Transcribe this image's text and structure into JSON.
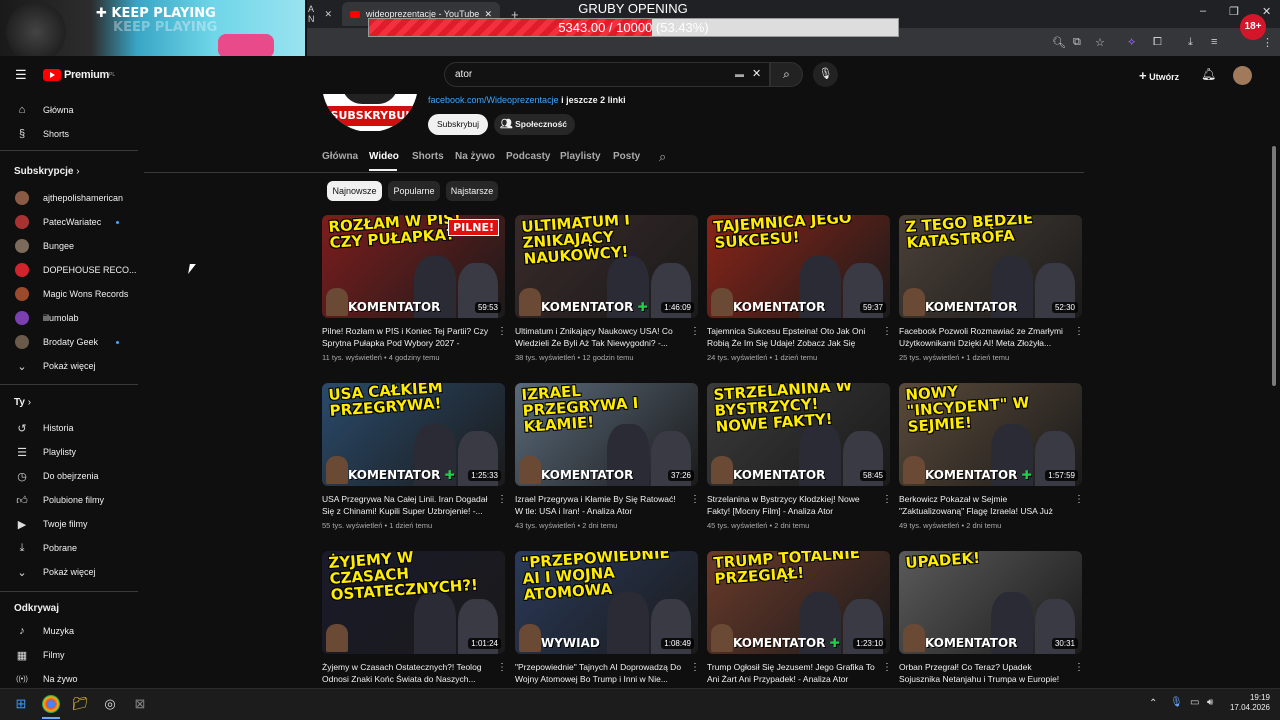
{
  "browser": {
    "tabs": [
      {
        "label": "A N"
      },
      {
        "label": "wideoprezentacje - YouTube"
      }
    ],
    "new_tab": "+",
    "window_controls": [
      "–",
      "❐",
      "✕"
    ]
  },
  "overlays": {
    "keep_playing": "KEEP PLAYING",
    "keep_playing_shadow": "KEEP PLAYING",
    "opening_title": "GRUBY OPENING",
    "progress_text": "5343.00 / 10000 (53.43%)",
    "progress_fraction": 0.5343,
    "age_badge": "18+"
  },
  "youtube": {
    "logo": "Premium",
    "logo_sup": "PL",
    "search_value": "ator",
    "create_label": "Utwórz"
  },
  "channel": {
    "avatar_text": "SUBSKRYBUJ",
    "links": "facebook.com/Wideoprezentacje",
    "links_more": "i jeszcze 2 linki",
    "subscribe": "Subskrybuj",
    "community": "Społeczność",
    "tabs": [
      "Główna",
      "Wideo",
      "Shorts",
      "Na żywo",
      "Podcasty",
      "Playlisty",
      "Posty"
    ],
    "active_tab": "Wideo",
    "chips": [
      "Najnowsze",
      "Popularne",
      "Najstarsze"
    ]
  },
  "sidebar": {
    "top": [
      {
        "label": "Główna",
        "icon": "home-icon"
      },
      {
        "label": "Shorts",
        "icon": "shorts-icon"
      }
    ],
    "subs_header": "Subskrypcje",
    "subs": [
      {
        "label": "ajthepolishamerican",
        "color": "#8a5a44",
        "dot": false
      },
      {
        "label": "PatecWariatec",
        "color": "#a83232",
        "dot": true
      },
      {
        "label": "Bungee",
        "color": "#7c6a5a",
        "dot": false
      },
      {
        "label": "DOPEHOUSE RECO...",
        "color": "#d2242c",
        "dot": false
      },
      {
        "label": "Magic Wons Records",
        "color": "#9b4a2c",
        "dot": false
      },
      {
        "label": "iilumolab",
        "color": "#7a3fb0",
        "dot": false
      },
      {
        "label": "Brodaty Geek",
        "color": "#6a5a4a",
        "dot": true
      }
    ],
    "show_more": "Pokaż więcej",
    "you_header": "Ty",
    "you": [
      {
        "label": "Historia",
        "icon": "history-icon"
      },
      {
        "label": "Playlisty",
        "icon": "playlists-icon"
      },
      {
        "label": "Do obejrzenia",
        "icon": "watch-later-icon"
      },
      {
        "label": "Polubione filmy",
        "icon": "liked-icon"
      },
      {
        "label": "Twoje filmy",
        "icon": "your-videos-icon"
      },
      {
        "label": "Pobrane",
        "icon": "downloads-icon"
      }
    ],
    "show_more_2": "Pokaż więcej",
    "explore_header": "Odkrywaj",
    "explore": [
      {
        "label": "Muzyka",
        "icon": "music-icon"
      },
      {
        "label": "Filmy",
        "icon": "movies-icon"
      },
      {
        "label": "Na żywo",
        "icon": "live-icon"
      }
    ]
  },
  "videos": [
    {
      "thumb": "ROZŁAM W PIS! CZY PUŁAPKA?",
      "badge": "PILNE!",
      "tag": "KOMENTATOR",
      "plus": false,
      "duration": "59:53",
      "bg": "#7d1d1d",
      "title": "Pilne! Rozłam w PIS i Koniec Tej Partii? Czy Sprytna Pułapka Pod Wybory 2027 - Analiz...",
      "views": "11 tys. wyświetleń",
      "age": "4 godziny temu"
    },
    {
      "thumb": "ULTIMATUM I ZNIKAJĄCY NAUKOWCY!",
      "badge": "",
      "tag": "KOMENTATOR",
      "plus": true,
      "duration": "1:46:09",
      "bg": "#3a2a2a",
      "title": "Ultimatum i Znikający Naukowcy USA! Co Wiedzieli Że Byli Aż Tak Niewygodni? -...",
      "views": "38 tys. wyświetleń",
      "age": "12 godzin temu"
    },
    {
      "thumb": "TAJEMNICA JEGO SUKCESU!",
      "badge": "",
      "tag": "KOMENTATOR",
      "plus": false,
      "duration": "59:37",
      "bg": "#8a2418",
      "title": "Tajemnica Sukcesu Epsteina! Oto Jak Oni Robią Że Im Się Udaje! Zobacz Jak Się Nie...",
      "views": "24 tys. wyświetleń",
      "age": "1 dzień temu"
    },
    {
      "thumb": "Z TEGO BĘDZIE KATASTROFA",
      "badge": "",
      "tag": "KOMENTATOR",
      "plus": false,
      "duration": "52:30",
      "bg": "#4a4038",
      "title": "Facebook Pozwoli Rozmawiać ze Zmarłymi Użytkownikami Dzięki AI! Meta Złożyła...",
      "views": "25 tys. wyświetleń",
      "age": "1 dzień temu"
    },
    {
      "thumb": "USA CAŁKIEM PRZEGRYWA!",
      "badge": "",
      "tag": "KOMENTATOR",
      "plus": true,
      "duration": "1:25:33",
      "bg": "#2a4a6a",
      "title": "USA Przegrywa Na Całej Linii. Iran Dogadał Się z Chinami! Kupili Super Uzbrojenie! -...",
      "views": "55 tys. wyświetleń",
      "age": "1 dzień temu"
    },
    {
      "thumb": "IZRAEL PRZEGRYWA I KŁAMIE!",
      "badge": "",
      "tag": "KOMENTATOR",
      "plus": false,
      "duration": "37:26",
      "bg": "#5a6a7a",
      "title": "Izrael Przegrywa i Kłamie By Się Ratować! W tle: USA i Iran! - Analiza Ator",
      "views": "43 tys. wyświetleń",
      "age": "2 dni temu"
    },
    {
      "thumb": "STRZELANINA W BYSTRZYCY! NOWE FAKTY!",
      "badge": "",
      "tag": "KOMENTATOR",
      "plus": false,
      "duration": "58:45",
      "bg": "#3a3a3a",
      "title": "Strzelanina w Bystrzycy Kłodzkiej! Nowe Fakty! [Mocny Film] - Analiza Ator",
      "views": "45 tys. wyświetleń",
      "age": "2 dni temu"
    },
    {
      "thumb": "NOWY \"INCYDENT\" W SEJMIE!",
      "badge": "",
      "tag": "KOMENTATOR",
      "plus": true,
      "duration": "1:57:59",
      "bg": "#5a4a3a",
      "title": "Berkowicz Pokazał w Sejmie \"Zaktualizowaną\" Flagę Izraela! USA Już Si...",
      "views": "49 tys. wyświetleń",
      "age": "2 dni temu"
    },
    {
      "thumb": "ŻYJEMY W CZASACH OSTATECZNYCH?!",
      "badge": "",
      "tag": "",
      "plus": false,
      "duration": "1:01:24",
      "bg": "#1a1a2a",
      "title": "Żyjemy w Czasach Ostatecznych?! Teolog Odnosi Znaki Końc Świata do Naszych...",
      "views": "",
      "age": ""
    },
    {
      "thumb": "\"PRZEPOWIEDNIE\" AI I WOJNA ATOMOWA",
      "badge": "",
      "tag": "WYWIAD",
      "plus": false,
      "duration": "1:08:49",
      "bg": "#2a3a5a",
      "title": "\"Przepowiednie\" Tajnych AI Doprowadzą Do Wojny Atomowej Bo Trump i Inni w Nie...",
      "views": "",
      "age": ""
    },
    {
      "thumb": "TRUMP TOTALNIE PRZEGIĄŁ!",
      "badge": "",
      "tag": "KOMENTATOR",
      "plus": true,
      "duration": "1:23:10",
      "bg": "#6a3a2a",
      "title": "Trump Ogłosił Się Jezusem! Jego Grafika To Ani Żart Ani Przypadek! - Analiza Ator",
      "views": "",
      "age": ""
    },
    {
      "thumb": "UPADEK!",
      "badge": "",
      "tag": "KOMENTATOR",
      "plus": false,
      "duration": "30:31",
      "bg": "#5a5a5a",
      "title": "Orban Przegrał! Co Teraz? Upadek Sojusznika Netanjahu i Trumpa w Europie! -...",
      "views": "",
      "age": ""
    }
  ],
  "taskbar": {
    "time": "19:19",
    "date": "17.04.2026"
  },
  "colors": {
    "accent": "#3ea6ff",
    "youtube_red": "#ff0000",
    "thumb_yellow": "#ffec00"
  }
}
